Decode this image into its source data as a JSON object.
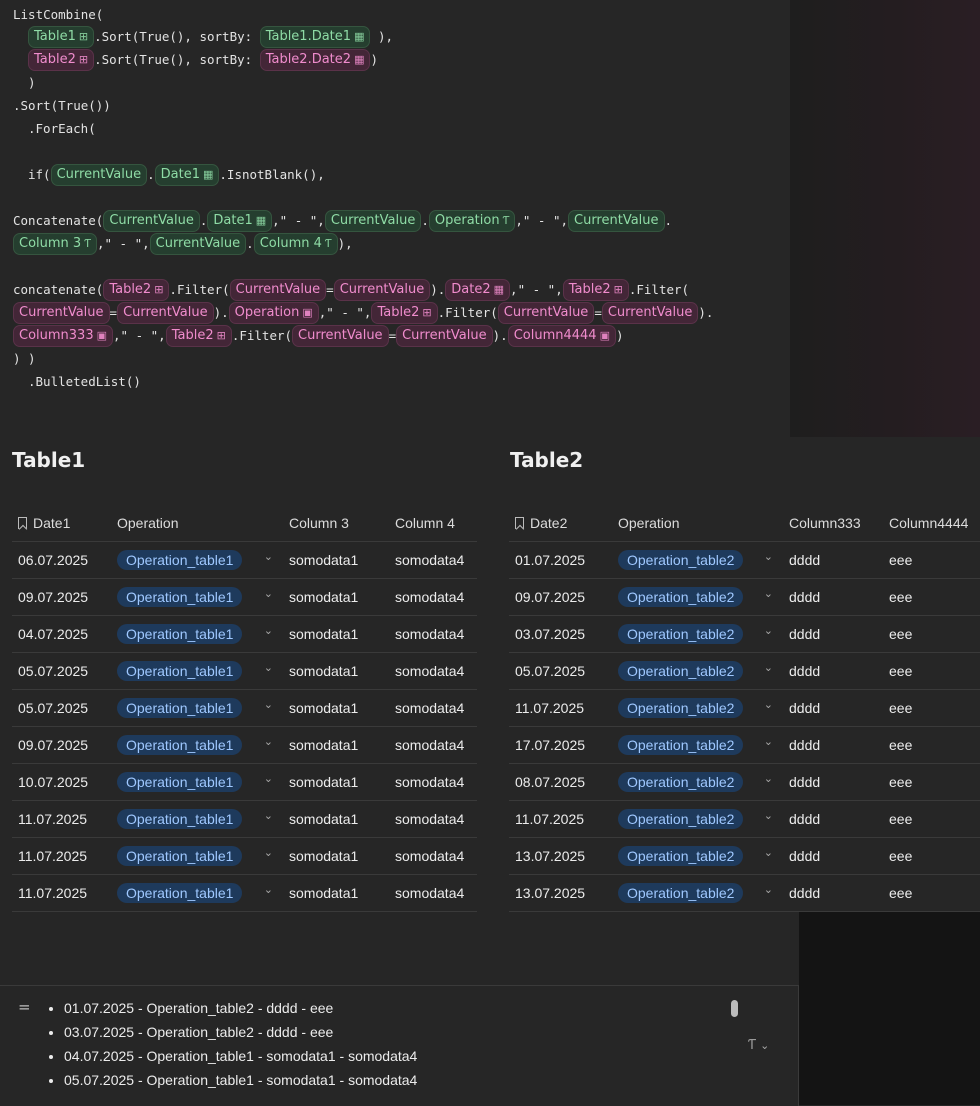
{
  "formula": {
    "l1": "ListCombine(",
    "table1": "Table1",
    "table2": "Table2",
    "sort_true": ".Sort(True(), sortBy: ",
    "close_comma": "),",
    "close": ")",
    "t1date1": "Table1.Date1",
    "t2date2": "Table2.Date2",
    "paren_close": ")",
    "l5": ".Sort(True())",
    "l6": ".ForEach(",
    "if_open": "if(",
    "current_value": "CurrentValue",
    "dot": ".",
    "date1": "Date1",
    "is_not_blank": ".IsnotBlank(),",
    "concat_cap": "Concatenate(",
    "sep": ",\" - \",",
    "operation": "Operation",
    "column3": "Column 3",
    "column4": "Column 4",
    "end_paren_comma": "),",
    "concat_low": "concatenate(",
    "filter_open": ".Filter(",
    "eq": "=",
    "filter_close_dot": ").",
    "date2": "Date2",
    "column333": "Column333",
    "column4444": "Column4444",
    "end_paren": ")",
    "close_close": ") )",
    "bulleted": ".BulletedList()"
  },
  "icons": {
    "table": "table-grid-icon",
    "calendar": "calendar-icon",
    "text": "text-type-icon",
    "select": "select-icon",
    "bookmark": "bookmark-icon",
    "chevron": "chevron-down-icon"
  },
  "table1": {
    "title": "Table1",
    "headers": [
      "Date1",
      "Operation",
      "Column 3",
      "Column 4"
    ],
    "rows": [
      [
        "06.07.2025",
        "Operation_table1",
        "somodata1",
        "somodata4"
      ],
      [
        "09.07.2025",
        "Operation_table1",
        "somodata1",
        "somodata4"
      ],
      [
        "04.07.2025",
        "Operation_table1",
        "somodata1",
        "somodata4"
      ],
      [
        "05.07.2025",
        "Operation_table1",
        "somodata1",
        "somodata4"
      ],
      [
        "05.07.2025",
        "Operation_table1",
        "somodata1",
        "somodata4"
      ],
      [
        "09.07.2025",
        "Operation_table1",
        "somodata1",
        "somodata4"
      ],
      [
        "10.07.2025",
        "Operation_table1",
        "somodata1",
        "somodata4"
      ],
      [
        "11.07.2025",
        "Operation_table1",
        "somodata1",
        "somodata4"
      ],
      [
        "11.07.2025",
        "Operation_table1",
        "somodata1",
        "somodata4"
      ],
      [
        "11.07.2025",
        "Operation_table1",
        "somodata1",
        "somodata4"
      ]
    ]
  },
  "table2": {
    "title": "Table2",
    "headers": [
      "Date2",
      "Operation",
      "Column333",
      "Column4444"
    ],
    "rows": [
      [
        "01.07.2025",
        "Operation_table2",
        "dddd",
        "eee"
      ],
      [
        "09.07.2025",
        "Operation_table2",
        "dddd",
        "eee"
      ],
      [
        "03.07.2025",
        "Operation_table2",
        "dddd",
        "eee"
      ],
      [
        "05.07.2025",
        "Operation_table2",
        "dddd",
        "eee"
      ],
      [
        "11.07.2025",
        "Operation_table2",
        "dddd",
        "eee"
      ],
      [
        "17.07.2025",
        "Operation_table2",
        "dddd",
        "eee"
      ],
      [
        "08.07.2025",
        "Operation_table2",
        "dddd",
        "eee"
      ],
      [
        "11.07.2025",
        "Operation_table2",
        "dddd",
        "eee"
      ],
      [
        "13.07.2025",
        "Operation_table2",
        "dddd",
        "eee"
      ],
      [
        "13.07.2025",
        "Operation_table2",
        "dddd",
        "eee"
      ]
    ]
  },
  "output": {
    "eq_symbol": "=",
    "items": [
      "01.07.2025 - Operation_table2 - dddd - eee",
      "03.07.2025 - Operation_table2 - dddd - eee",
      "04.07.2025 - Operation_table1 - somodata1 - somodata4",
      "05.07.2025 - Operation_table1 - somodata1 - somodata4"
    ],
    "format_glyph": "Ƭ"
  }
}
